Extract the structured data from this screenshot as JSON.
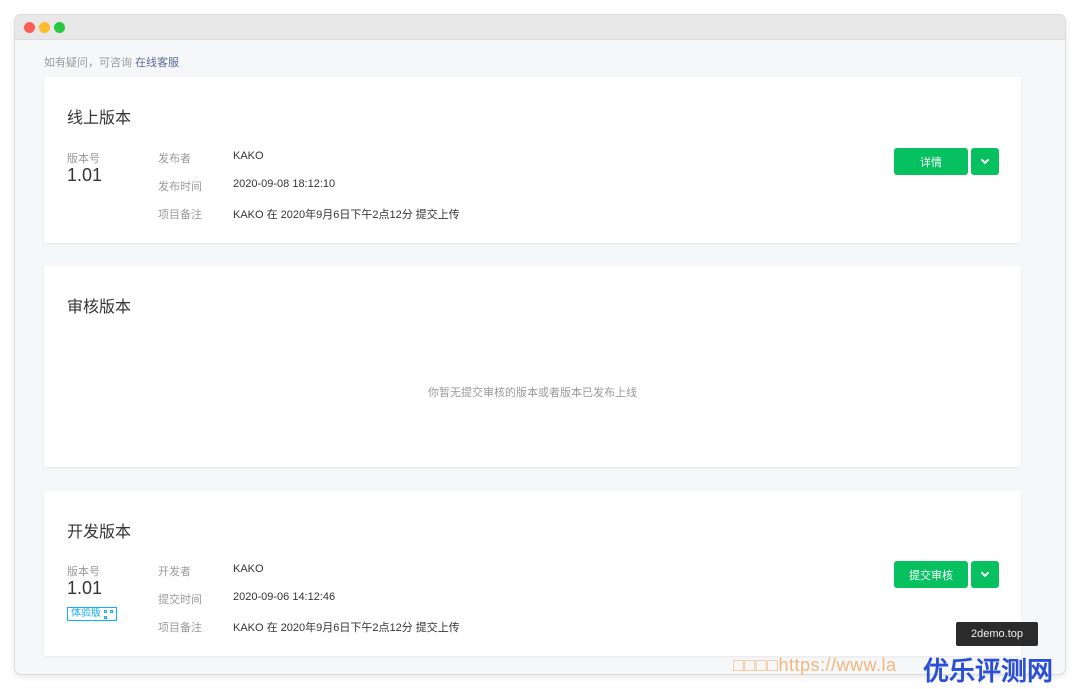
{
  "help": {
    "text": "如有疑问，可咨询 ",
    "link": "在线客服"
  },
  "online": {
    "title": "线上版本",
    "version_label": "版本号",
    "version": "1.01",
    "rows": [
      {
        "k": "发布者",
        "v": "KAKO"
      },
      {
        "k": "发布时间",
        "v": "2020-09-08 18:12:10"
      },
      {
        "k": "项目备注",
        "v": "KAKO 在 2020年9月6日下午2点12分 提交上传"
      }
    ],
    "button": "详情"
  },
  "review": {
    "title": "审核版本",
    "empty_text": "你暂无提交审核的版本或者版本已发布上线"
  },
  "dev": {
    "title": "开发版本",
    "version_label": "版本号",
    "version": "1.01",
    "tag": "体验版",
    "rows": [
      {
        "k": "开发者",
        "v": "KAKO"
      },
      {
        "k": "提交时间",
        "v": "2020-09-06 14:12:46"
      },
      {
        "k": "项目备注",
        "v": "KAKO 在 2020年9月6日下午2点12分 提交上传"
      }
    ],
    "button": "提交审核"
  },
  "tooltip": "2demo.top",
  "watermark": {
    "url": "□□□□https://www.la",
    "brand": "优乐评测网"
  },
  "colors": {
    "primary": "#07c160",
    "link": "#576b95",
    "tag": "#10aeff",
    "background": "#f6f7f9"
  }
}
